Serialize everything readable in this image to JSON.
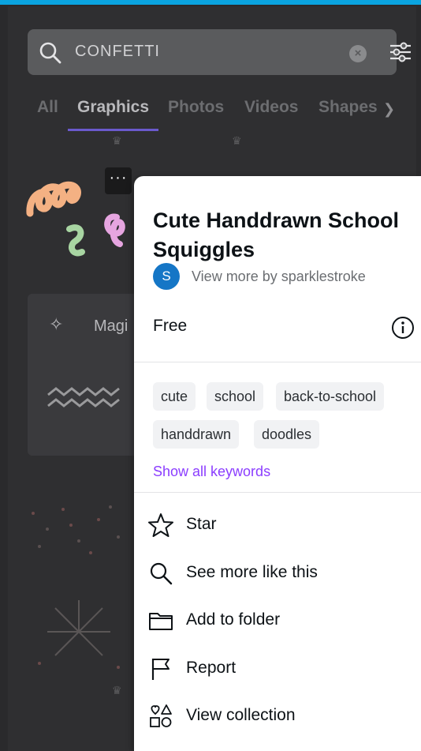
{
  "search": {
    "query": "CONFETTI"
  },
  "tabs": [
    {
      "label": "All",
      "active": false
    },
    {
      "label": "Graphics",
      "active": true
    },
    {
      "label": "Photos",
      "active": false
    },
    {
      "label": "Videos",
      "active": false
    },
    {
      "label": "Shapes",
      "active": false
    }
  ],
  "magic": {
    "label": "Magi"
  },
  "more_button": {
    "label": "···"
  },
  "details": {
    "title": "Cute Handdrawn School Squiggles",
    "creator_initial": "S",
    "creator_link": "View more by sparklestroke",
    "price": "Free",
    "keywords": [
      "cute",
      "school",
      "back-to-school",
      "handdrawn",
      "doodles"
    ],
    "show_all_keywords": "Show all keywords"
  },
  "menu": [
    {
      "label": "Star",
      "icon": "star-icon"
    },
    {
      "label": "See more like this",
      "icon": "search-icon"
    },
    {
      "label": "Add to folder",
      "icon": "folder-icon"
    },
    {
      "label": "Report",
      "icon": "flag-icon"
    },
    {
      "label": "View collection",
      "icon": "collection-icon"
    }
  ],
  "colors": {
    "accent": "#8b3dff",
    "tab_underline": "#6a5acd",
    "avatar": "#1576c6",
    "topbar": "#0aa4e0"
  }
}
